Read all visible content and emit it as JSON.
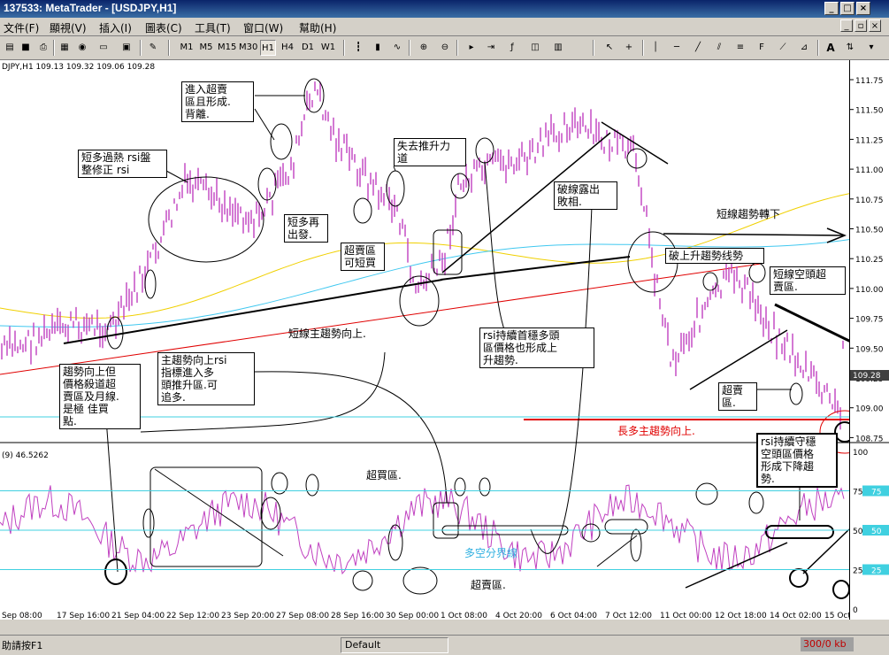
{
  "window": {
    "title": "137533: MetaTrader - [USDJPY,H1]"
  },
  "menu": [
    "文件(F)",
    "顯視(V)",
    "插入(I)",
    "圖表(C)",
    "工具(T)",
    "窗口(W)",
    "幫助(H)"
  ],
  "toolbar": {
    "timeframes": [
      "M1",
      "M5",
      "M15",
      "M30",
      "H1",
      "H4",
      "D1",
      "W1"
    ],
    "selected": "H1"
  },
  "chart": {
    "header": "DJPY,H1  109.13 109.32 109.06 109.28",
    "price_label": "109.28",
    "indicator_header": "(9)  46.5262",
    "price_ticks": [
      "111.75",
      "111.50",
      "111.25",
      "111.00",
      "110.75",
      "110.50",
      "110.25",
      "110.00",
      "109.75",
      "109.50",
      "109.25",
      "109.00",
      "108.75"
    ],
    "rsi_ticks": [
      "100",
      "75",
      "50",
      "25",
      "0"
    ],
    "rsi_marked": [
      "75",
      "50",
      "25"
    ],
    "time_ticks": [
      "Sep 08:00",
      "17 Sep 16:00",
      "21 Sep 04:00",
      "22 Sep 12:00",
      "23 Sep 20:00",
      "27 Sep 08:00",
      "28 Sep 16:00",
      "30 Sep 00:00",
      "1 Oct 08:00",
      "4 Oct 20:00",
      "6 Oct 04:00",
      "7 Oct 12:00",
      "11 Oct 00:00",
      "12 Oct 18:00",
      "14 Oct 02:00",
      "15 Oct 10:00"
    ],
    "colors": {
      "candles": "#c040c0",
      "ma_yellow": "#f0d000",
      "ma_cyan": "#40c8f0",
      "trend_red": "#e00000",
      "rsi_levels": "#40d0e0"
    }
  },
  "annotations": {
    "enter_overbought": "進入超賣\n區且形成.\n背離.",
    "short_overheat": "短多過熱 rsi盤\n整修正 rsi",
    "lose_push": "失去推升力\n道",
    "short_restart": "短多再\n出發.",
    "oversold_buy": "超賣區\n可短買",
    "break_down": "破線露出\n敗相.",
    "short_trend_down": "短線趨勢轉下",
    "break_up_trend": "破上升趨勢线勢",
    "short_bear": "短線空頭超\n賣區.",
    "short_main_up": "短線主趨勢向上.",
    "rsi_bull": "rsi持續首穩多頭\n區價格也形成上\n升趨勢.",
    "trend_up_but": "趨勢向上但\n價格殺道超\n賣區及月線.\n是極 佳買\n點.",
    "main_trend_up": "主趨勢向上rsi\n指標進入多\n頭推升區.可\n追多.",
    "oversold_label": "超賣\n區.",
    "long_main_up": "長多主趨勢向上.",
    "rsi_bear": "rsi持續守穩\n空頭區價格\n形成下降趨\n勢.",
    "overbought_zone": "超買區.",
    "bull_bear_line": "多空分界線",
    "oversold_zone": "超賣區."
  },
  "statusbar": {
    "help": "助請按F1",
    "profile": "Default",
    "traffic": "300/0 kb"
  }
}
